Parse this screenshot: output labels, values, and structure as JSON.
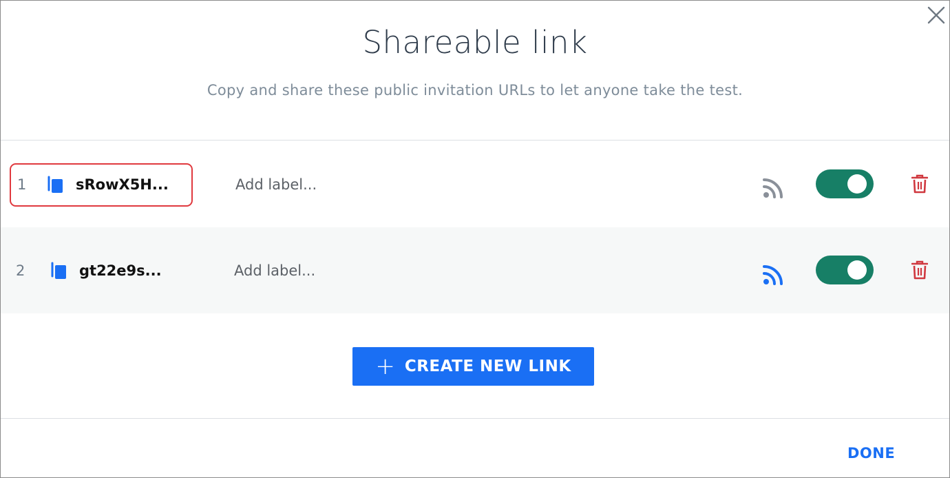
{
  "dialog": {
    "title": "Shareable link",
    "subtitle": "Copy and share these public invitation URLs to let anyone take the test.",
    "close_icon": "close-icon"
  },
  "links": [
    {
      "number": "1",
      "code": "sRowX5H...",
      "label_placeholder": "Add label...",
      "rss_icon": "rss-icon",
      "rss_color": "#8a9099",
      "enabled": true,
      "toggle_color": "#177f66",
      "highlighted": true
    },
    {
      "number": "2",
      "code": "gt22e9s...",
      "label_placeholder": "Add label...",
      "rss_icon": "rss-icon",
      "rss_color": "#1a6ff4",
      "enabled": true,
      "toggle_color": "#177f66",
      "highlighted": false
    }
  ],
  "actions": {
    "create_label": "CREATE NEW LINK",
    "create_icon": "plus-icon",
    "done_label": "DONE"
  },
  "colors": {
    "accent": "#1a6ff4",
    "toggle_on": "#177f66",
    "delete": "#d0383f",
    "highlight": "#e0393e"
  }
}
